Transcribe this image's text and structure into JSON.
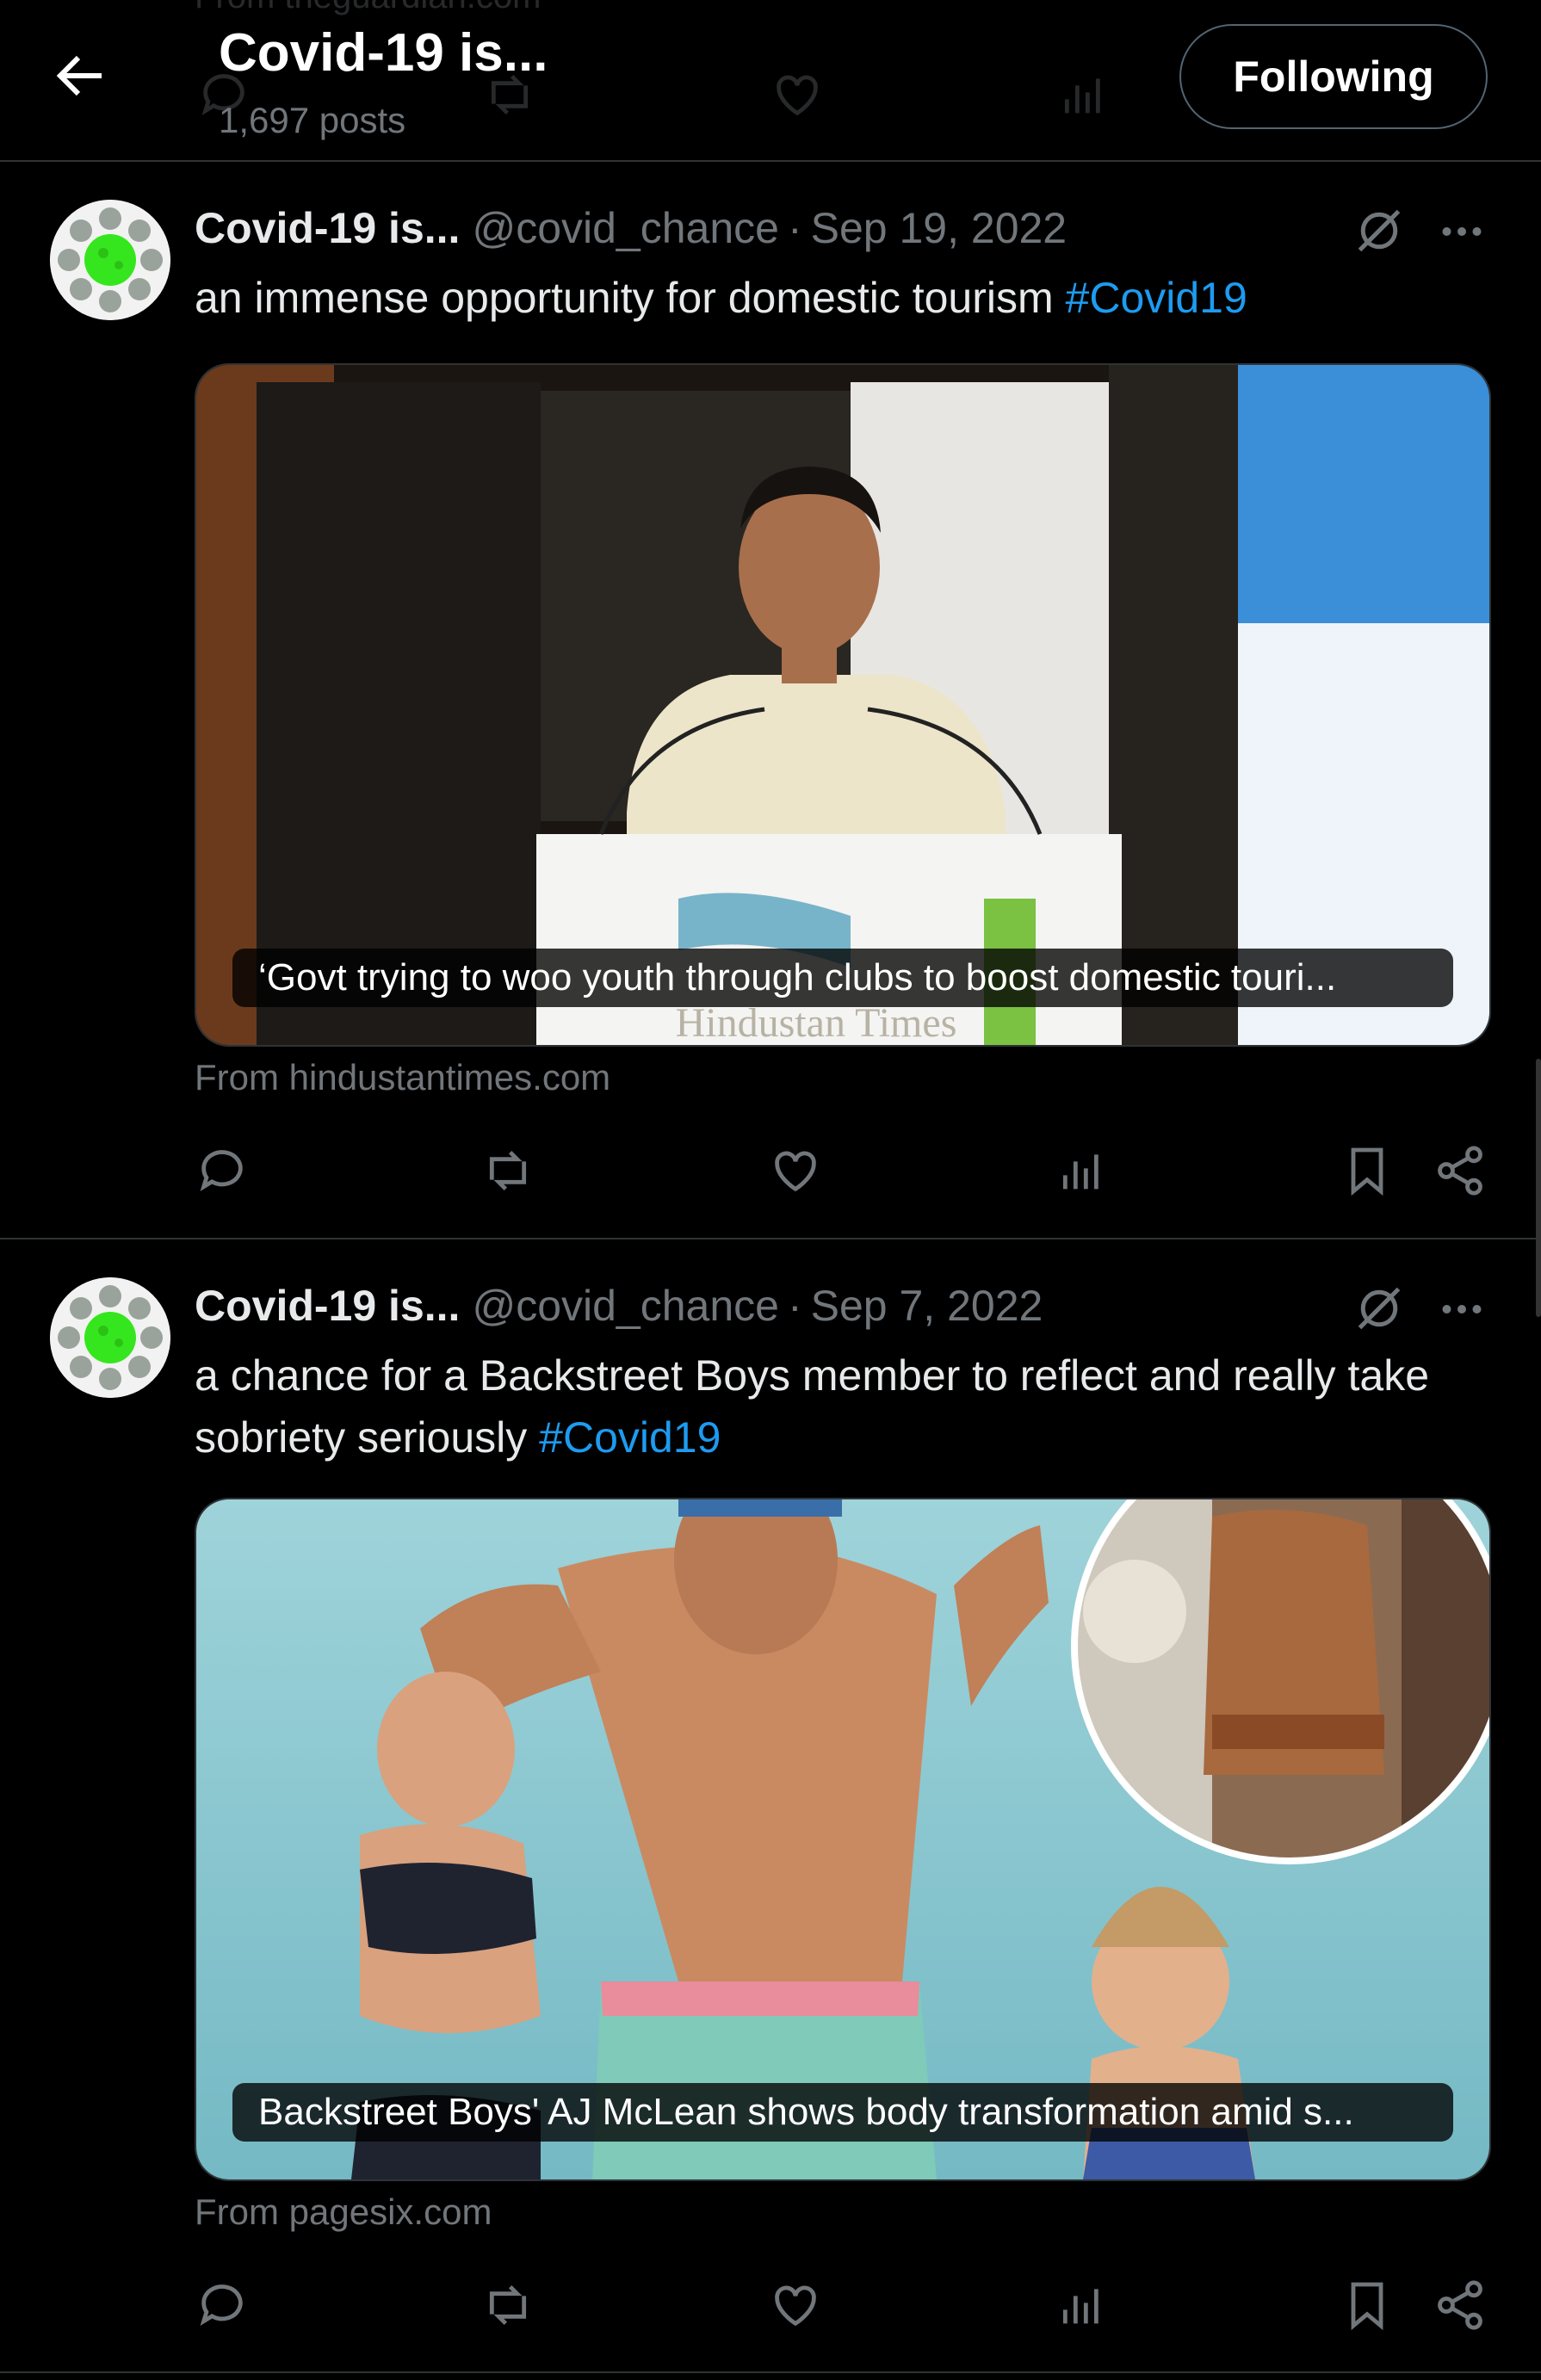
{
  "header": {
    "title": "Covid-19 is...",
    "post_count": "1,697 posts",
    "follow_label": "Following",
    "scrolled_source": "From theguardian.com"
  },
  "posts": [
    {
      "name": "Covid-19 is...",
      "handle": "@covid_chance",
      "date": "Sep 19, 2022",
      "text": "an immense opportunity for domestic tourism ",
      "hashtag": "#Covid19",
      "card_caption": "‘Govt trying to woo youth through clubs to boost domestic touri...",
      "card_watermark": "Hindustan Times",
      "source": "From hindustantimes.com"
    },
    {
      "name": "Covid-19 is...",
      "handle": "@covid_chance",
      "date": "Sep 7, 2022",
      "text": "a chance for a Backstreet Boys member to reflect and really take sobriety seriously ",
      "hashtag": "#Covid19",
      "card_caption": "Backstreet Boys' AJ McLean shows body transformation amid s...",
      "source": "From pagesix.com"
    }
  ],
  "icons": [
    "back-arrow-icon",
    "grok-icon",
    "more-icon",
    "reply-icon",
    "repost-icon",
    "like-icon",
    "views-icon",
    "bookmark-icon",
    "share-icon"
  ],
  "colors": {
    "background": "#000000",
    "text": "#e7e9ea",
    "muted": "#71767b",
    "link": "#1d9bf0",
    "border": "#2f3336",
    "avatar_virus": "#35e61e"
  }
}
